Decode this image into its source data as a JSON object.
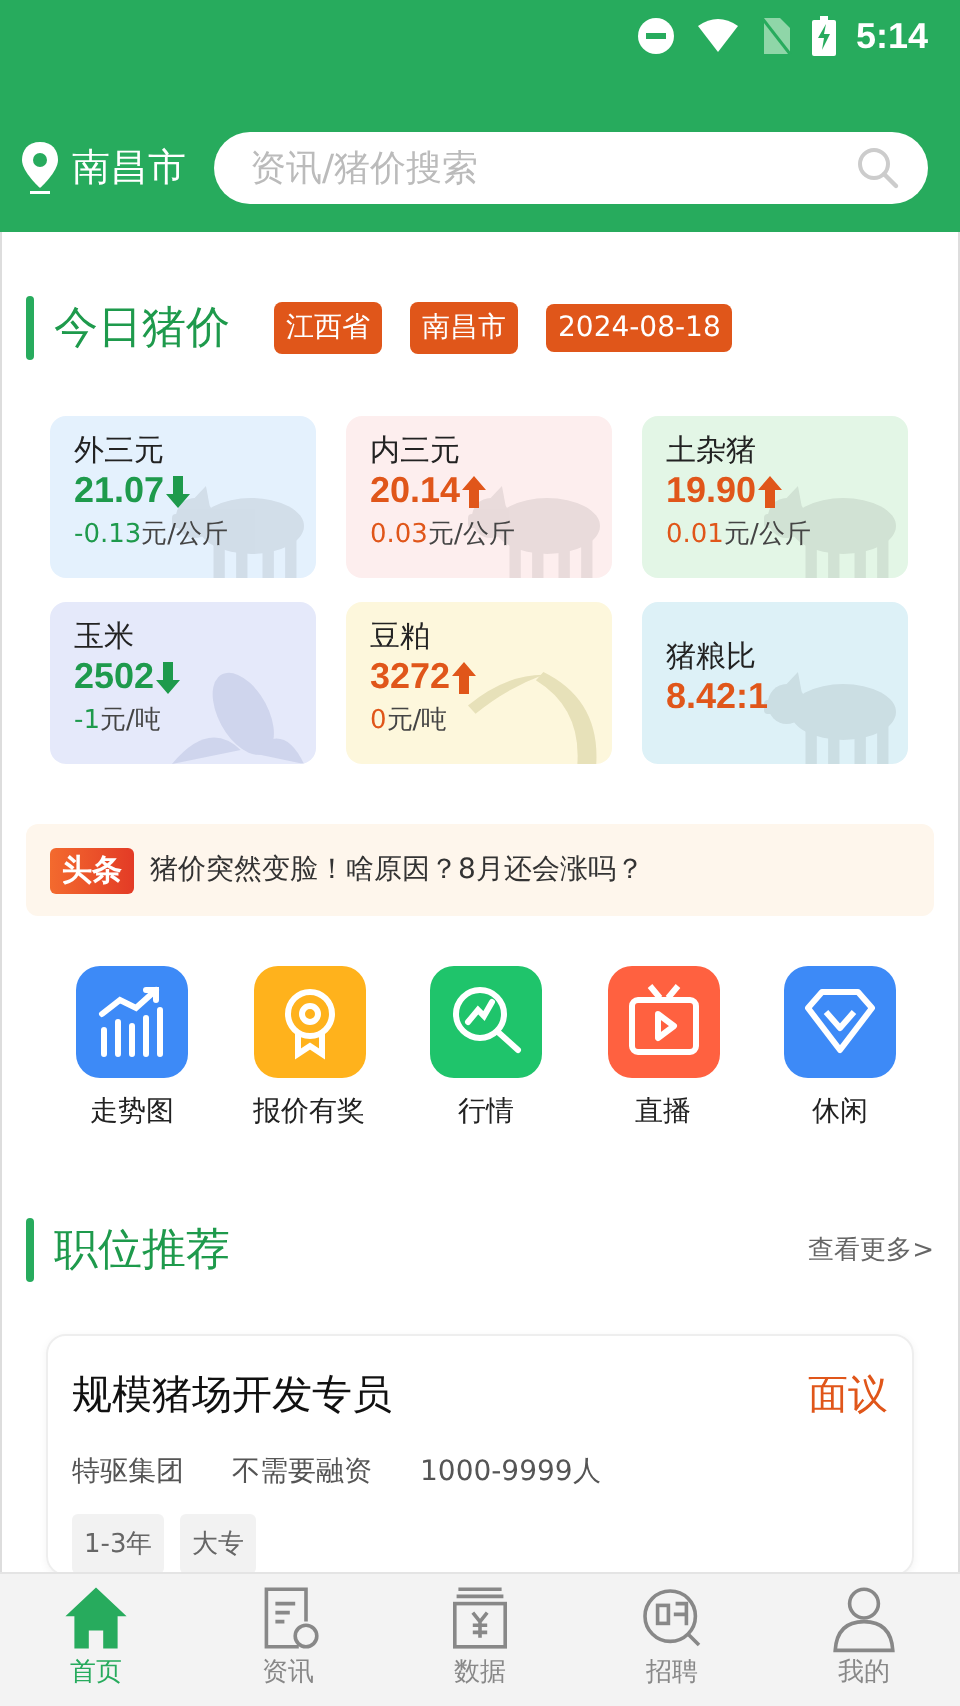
{
  "status_bar": {
    "time": "5:14"
  },
  "header": {
    "city": "南昌市",
    "search": {
      "placeholder": "资讯/猪价搜索"
    }
  },
  "prices": {
    "title": "今日猪价",
    "tags": [
      "江西省",
      "南昌市",
      "2024-08-18"
    ],
    "cards": [
      {
        "name": "外三元",
        "value": "21.07",
        "up": false,
        "arrow": true,
        "change": "-0.13",
        "unit": "元/公斤",
        "color": "#e4f1fd",
        "kind": "pig"
      },
      {
        "name": "内三元",
        "value": "20.14",
        "up": true,
        "arrow": true,
        "change": "0.03",
        "unit": "元/公斤",
        "color": "#fdeeee",
        "kind": "pig"
      },
      {
        "name": "土杂猪",
        "value": "19.90",
        "up": true,
        "arrow": true,
        "change": "0.01",
        "unit": "元/公斤",
        "color": "#e3f6e6",
        "kind": "pig"
      },
      {
        "name": "玉米",
        "value": "2502",
        "up": false,
        "arrow": true,
        "change": "-1",
        "unit": "元/吨",
        "color": "#e5e9fa",
        "kind": "corn"
      },
      {
        "name": "豆粕",
        "value": "3272",
        "up": true,
        "arrow": true,
        "change": "0",
        "unit": "元/吨",
        "color": "#fdf7dc",
        "kind": "bean"
      },
      {
        "name": "猪粮比",
        "value": "8.42:1",
        "up": true,
        "arrow": false,
        "color": "#ddf1f7",
        "kind": "pig"
      }
    ]
  },
  "headline": {
    "badge": "头条",
    "text": "猪价突然变脸！啥原因？8月还会涨吗？"
  },
  "shortcuts": [
    {
      "label": "走势图",
      "kind": "chart",
      "color": "#3d8af7"
    },
    {
      "label": "报价有奖",
      "kind": "award",
      "color": "#ffb21c"
    },
    {
      "label": "行情",
      "kind": "search",
      "color": "#1fc46b"
    },
    {
      "label": "直播",
      "kind": "tv",
      "color": "#ff6140"
    },
    {
      "label": "休闲",
      "kind": "diamond",
      "color": "#3d8af7"
    }
  ],
  "jobs": {
    "title": "职位推荐",
    "more": "查看更多>",
    "items": [
      {
        "title": "规模猪场开发专员",
        "salary": "面议",
        "company": "特驱集团",
        "funding": "不需要融资",
        "size": "1000-9999人",
        "tags": [
          "1-3年",
          "大专"
        ]
      }
    ]
  },
  "tab_bar": [
    {
      "label": "首页",
      "kind": "home",
      "selected": true
    },
    {
      "label": "资讯",
      "kind": "news",
      "selected": false
    },
    {
      "label": "数据",
      "kind": "data",
      "selected": false
    },
    {
      "label": "招聘",
      "kind": "hire",
      "selected": false
    },
    {
      "label": "我的",
      "kind": "user",
      "selected": false
    }
  ]
}
